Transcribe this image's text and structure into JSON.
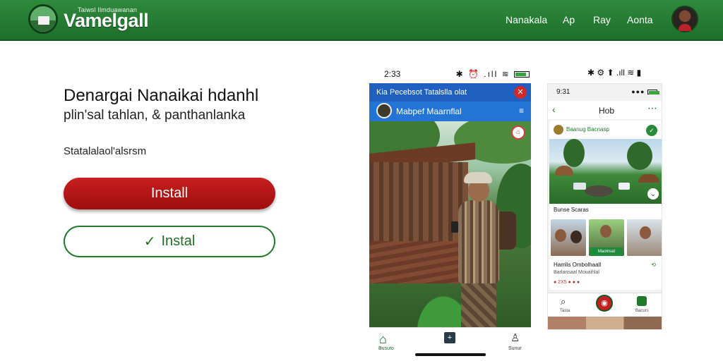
{
  "header": {
    "brand_small": "Taiwsl Ilmduawanan",
    "brand": "Vamelgall",
    "nav": [
      "Nanakala",
      "Ap",
      "Ray",
      "Aonta"
    ]
  },
  "hero": {
    "headline": "Denargai Nanaikai hdanhl",
    "subline": "plin'sal tahlan, & panthanlanka",
    "small_text": "Statalalaol'alsrsm",
    "btn_primary": "Install",
    "btn_secondary": "Instal",
    "check_icon": "✓"
  },
  "phone1": {
    "time": "2:33",
    "status_icons": "✱ ⏰ .ıll ≋",
    "header": "Kia  Pecebsot Tatalslla olat",
    "close": "✕",
    "subheader": "Mabpef Maarnflal",
    "more": "≡",
    "pin": "⌂",
    "nav_home_label": "Busuto",
    "nav_user_label": "Sunur"
  },
  "phone2": {
    "status": "✱ ⚙ ⬆ .ıll ≋ ▮",
    "time": "9:31",
    "title": "Hob",
    "channel": "Baanug Bacnasp",
    "section": "Bunse Scaras",
    "tag": "Maolnsat",
    "name": "Hamlis Ombolhaall",
    "sub": "Barlansaal Mouaihlal",
    "likes": "● 2X5  ●  ●  ●",
    "nav_search_label": "Tasta",
    "nav_green_label": "Bacurs"
  },
  "colors": {
    "brand_green": "#2f8a3c",
    "install_red": "#c81f1f",
    "blue_header": "#1f5fbf"
  }
}
